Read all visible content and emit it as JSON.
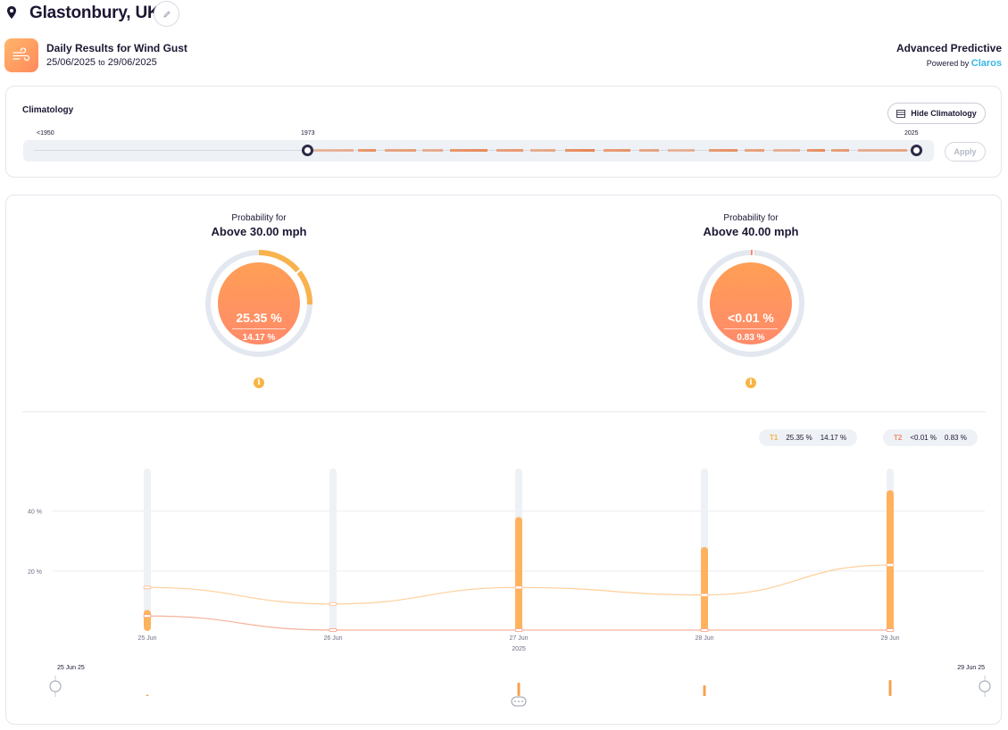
{
  "location": {
    "title": "Glastonbury, UK",
    "icons": {
      "pin": "map-pin-icon",
      "edit": "pencil-icon"
    }
  },
  "results_header": {
    "title": "Daily Results for Wind Gust",
    "date_from": "25/06/2025",
    "date_sep": "to",
    "date_to": "29/06/2025",
    "badge_icon": "wind-icon",
    "product": "Advanced Predictive",
    "powered_by": "Powered by",
    "brand": "Claros"
  },
  "climatology": {
    "title": "Climatology",
    "hide_button": "Hide Climatology",
    "hide_icon": "table-icon",
    "range_start_label": "<1950",
    "selected_start_label": "1973",
    "range_end_label": "2025",
    "apply_button": "Apply",
    "selected_range": [
      1973,
      2025
    ],
    "bar_color": "#e8814a"
  },
  "gauges": [
    {
      "caption": "Probability for",
      "threshold": "Above 30.00 mph",
      "forecast_pct": "25.35 %",
      "climatology_pct": "14.17 %",
      "forecast_fraction": 0.2535,
      "climatology_fraction": 0.1417,
      "info_icon": "info-icon"
    },
    {
      "caption": "Probability for",
      "threshold": "Above 40.00 mph",
      "forecast_pct": "<0.01 %",
      "climatology_pct": "0.83 %",
      "forecast_fraction": 0.0001,
      "climatology_fraction": 0.0083,
      "info_icon": "info-icon"
    }
  ],
  "legend": [
    {
      "tag": "T1",
      "forecast": "25.35 %",
      "climatology": "14.17 %"
    },
    {
      "tag": "T2",
      "forecast": "<0.01 %",
      "climatology": "0.83 %"
    }
  ],
  "colors": {
    "accent_orange": "#ffb25e",
    "accent_coral": "#f38a6b",
    "dark": "#1d1633",
    "brand_blue": "#3ab7e6",
    "track": "#eef1f5"
  },
  "chart_data": {
    "type": "bar",
    "categories": [
      "25 Jun",
      "26 Jun",
      "27 Jun",
      "28 Jun",
      "29 Jun"
    ],
    "xlabel": "2025",
    "ylabel": "",
    "ylim": [
      0,
      56
    ],
    "yticks": [
      20,
      40
    ],
    "ytick_labels": [
      "20 %",
      "40 %"
    ],
    "grid": true,
    "series": [
      {
        "name": "T1",
        "type": "bar",
        "values": [
          7,
          0,
          38,
          28,
          47
        ],
        "climatology": [
          14.5,
          9,
          14.5,
          12,
          22
        ]
      },
      {
        "name": "T2",
        "type": "line",
        "values": [
          0,
          0,
          0,
          0,
          0
        ],
        "climatology": [
          5,
          0.3,
          0.3,
          0.3,
          0.3
        ]
      }
    ]
  },
  "timeline": {
    "start_label": "25 Jun 25",
    "end_label": "29 Jun 25",
    "handle_icon": "drag-handle-icon",
    "mini_values": [
      0.5,
      0,
      5,
      4,
      6
    ]
  }
}
